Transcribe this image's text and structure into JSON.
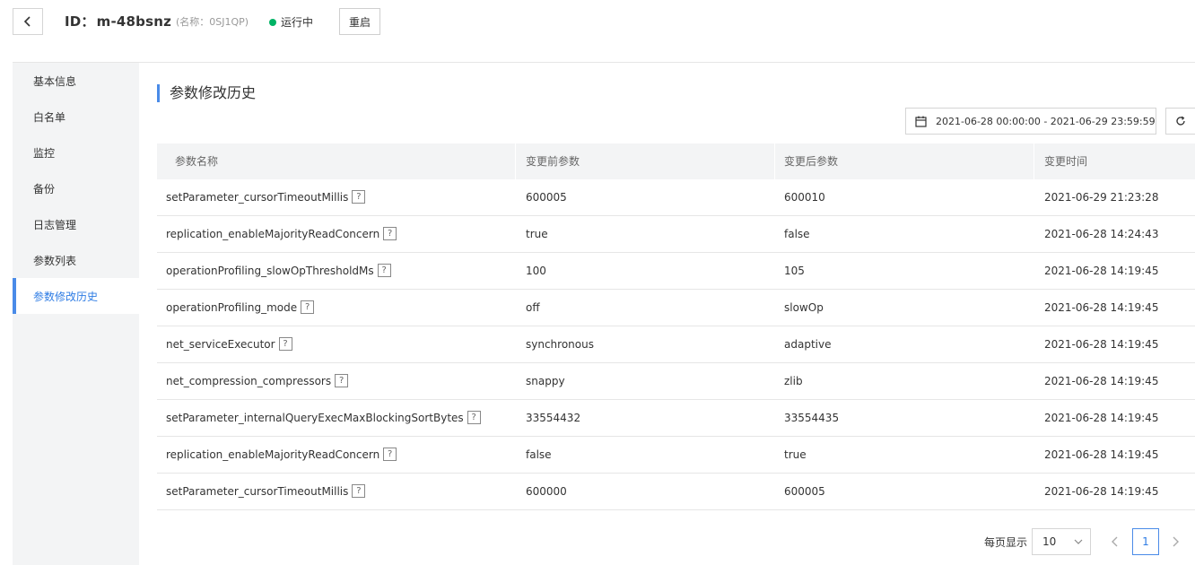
{
  "header": {
    "id_label": "ID：",
    "id_value": "m-48bsnz",
    "name_text": "(名称：0SJ1QP)",
    "status_text": "运行中",
    "status_color": "#00b365",
    "restart_label": "重启",
    "back_icon": "chevron-left-icon"
  },
  "sidebar": {
    "items": [
      {
        "label": "基本信息",
        "active": false
      },
      {
        "label": "白名单",
        "active": false
      },
      {
        "label": "监控",
        "active": false
      },
      {
        "label": "备份",
        "active": false
      },
      {
        "label": "日志管理",
        "active": false
      },
      {
        "label": "参数列表",
        "active": false
      },
      {
        "label": "参数修改历史",
        "active": true
      }
    ]
  },
  "main": {
    "section_title": "参数修改历史",
    "date_range": "2021-06-28 00:00:00 - 2021-06-29 23:59:59",
    "accent_color": "#4a8be8",
    "table": {
      "columns": [
        "参数名称",
        "变更前参数",
        "变更后参数",
        "变更时间"
      ],
      "help_glyph": "?",
      "rows": [
        {
          "name": "setParameter_cursorTimeoutMillis",
          "before": "600005",
          "after": "600010",
          "time": "2021-06-29 21:23:28"
        },
        {
          "name": "replication_enableMajorityReadConcern",
          "before": "true",
          "after": "false",
          "time": "2021-06-28 14:24:43"
        },
        {
          "name": "operationProfiling_slowOpThresholdMs",
          "before": "100",
          "after": "105",
          "time": "2021-06-28 14:19:45"
        },
        {
          "name": "operationProfiling_mode",
          "before": "off",
          "after": "slowOp",
          "time": "2021-06-28 14:19:45"
        },
        {
          "name": "net_serviceExecutor",
          "before": "synchronous",
          "after": "adaptive",
          "time": "2021-06-28 14:19:45"
        },
        {
          "name": "net_compression_compressors",
          "before": "snappy",
          "after": "zlib",
          "time": "2021-06-28 14:19:45"
        },
        {
          "name": "setParameter_internalQueryExecMaxBlockingSortBytes",
          "before": "33554432",
          "after": "33554435",
          "time": "2021-06-28 14:19:45"
        },
        {
          "name": "replication_enableMajorityReadConcern",
          "before": "false",
          "after": "true",
          "time": "2021-06-28 14:19:45"
        },
        {
          "name": "setParameter_cursorTimeoutMillis",
          "before": "600000",
          "after": "600005",
          "time": "2021-06-28 14:19:45"
        }
      ]
    },
    "pagination": {
      "page_size_label": "每页显示",
      "page_size": "10",
      "current_page": "1"
    }
  }
}
